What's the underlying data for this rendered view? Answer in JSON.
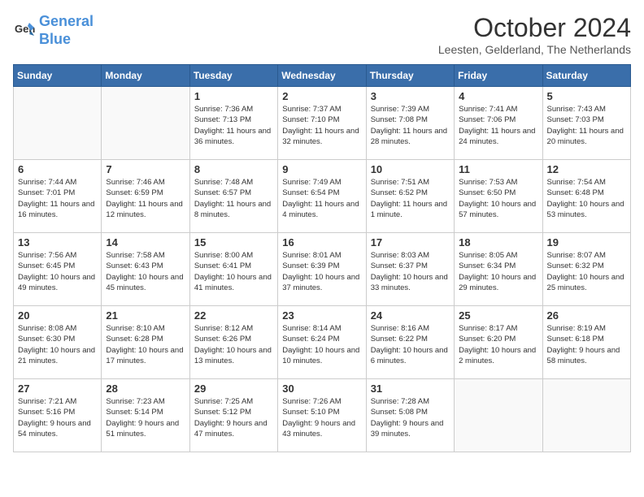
{
  "header": {
    "logo_line1": "General",
    "logo_line2": "Blue",
    "month": "October 2024",
    "location": "Leesten, Gelderland, The Netherlands"
  },
  "weekdays": [
    "Sunday",
    "Monday",
    "Tuesday",
    "Wednesday",
    "Thursday",
    "Friday",
    "Saturday"
  ],
  "weeks": [
    [
      {
        "day": "",
        "info": ""
      },
      {
        "day": "",
        "info": ""
      },
      {
        "day": "1",
        "info": "Sunrise: 7:36 AM\nSunset: 7:13 PM\nDaylight: 11 hours and 36 minutes."
      },
      {
        "day": "2",
        "info": "Sunrise: 7:37 AM\nSunset: 7:10 PM\nDaylight: 11 hours and 32 minutes."
      },
      {
        "day": "3",
        "info": "Sunrise: 7:39 AM\nSunset: 7:08 PM\nDaylight: 11 hours and 28 minutes."
      },
      {
        "day": "4",
        "info": "Sunrise: 7:41 AM\nSunset: 7:06 PM\nDaylight: 11 hours and 24 minutes."
      },
      {
        "day": "5",
        "info": "Sunrise: 7:43 AM\nSunset: 7:03 PM\nDaylight: 11 hours and 20 minutes."
      }
    ],
    [
      {
        "day": "6",
        "info": "Sunrise: 7:44 AM\nSunset: 7:01 PM\nDaylight: 11 hours and 16 minutes."
      },
      {
        "day": "7",
        "info": "Sunrise: 7:46 AM\nSunset: 6:59 PM\nDaylight: 11 hours and 12 minutes."
      },
      {
        "day": "8",
        "info": "Sunrise: 7:48 AM\nSunset: 6:57 PM\nDaylight: 11 hours and 8 minutes."
      },
      {
        "day": "9",
        "info": "Sunrise: 7:49 AM\nSunset: 6:54 PM\nDaylight: 11 hours and 4 minutes."
      },
      {
        "day": "10",
        "info": "Sunrise: 7:51 AM\nSunset: 6:52 PM\nDaylight: 11 hours and 1 minute."
      },
      {
        "day": "11",
        "info": "Sunrise: 7:53 AM\nSunset: 6:50 PM\nDaylight: 10 hours and 57 minutes."
      },
      {
        "day": "12",
        "info": "Sunrise: 7:54 AM\nSunset: 6:48 PM\nDaylight: 10 hours and 53 minutes."
      }
    ],
    [
      {
        "day": "13",
        "info": "Sunrise: 7:56 AM\nSunset: 6:45 PM\nDaylight: 10 hours and 49 minutes."
      },
      {
        "day": "14",
        "info": "Sunrise: 7:58 AM\nSunset: 6:43 PM\nDaylight: 10 hours and 45 minutes."
      },
      {
        "day": "15",
        "info": "Sunrise: 8:00 AM\nSunset: 6:41 PM\nDaylight: 10 hours and 41 minutes."
      },
      {
        "day": "16",
        "info": "Sunrise: 8:01 AM\nSunset: 6:39 PM\nDaylight: 10 hours and 37 minutes."
      },
      {
        "day": "17",
        "info": "Sunrise: 8:03 AM\nSunset: 6:37 PM\nDaylight: 10 hours and 33 minutes."
      },
      {
        "day": "18",
        "info": "Sunrise: 8:05 AM\nSunset: 6:34 PM\nDaylight: 10 hours and 29 minutes."
      },
      {
        "day": "19",
        "info": "Sunrise: 8:07 AM\nSunset: 6:32 PM\nDaylight: 10 hours and 25 minutes."
      }
    ],
    [
      {
        "day": "20",
        "info": "Sunrise: 8:08 AM\nSunset: 6:30 PM\nDaylight: 10 hours and 21 minutes."
      },
      {
        "day": "21",
        "info": "Sunrise: 8:10 AM\nSunset: 6:28 PM\nDaylight: 10 hours and 17 minutes."
      },
      {
        "day": "22",
        "info": "Sunrise: 8:12 AM\nSunset: 6:26 PM\nDaylight: 10 hours and 13 minutes."
      },
      {
        "day": "23",
        "info": "Sunrise: 8:14 AM\nSunset: 6:24 PM\nDaylight: 10 hours and 10 minutes."
      },
      {
        "day": "24",
        "info": "Sunrise: 8:16 AM\nSunset: 6:22 PM\nDaylight: 10 hours and 6 minutes."
      },
      {
        "day": "25",
        "info": "Sunrise: 8:17 AM\nSunset: 6:20 PM\nDaylight: 10 hours and 2 minutes."
      },
      {
        "day": "26",
        "info": "Sunrise: 8:19 AM\nSunset: 6:18 PM\nDaylight: 9 hours and 58 minutes."
      }
    ],
    [
      {
        "day": "27",
        "info": "Sunrise: 7:21 AM\nSunset: 5:16 PM\nDaylight: 9 hours and 54 minutes."
      },
      {
        "day": "28",
        "info": "Sunrise: 7:23 AM\nSunset: 5:14 PM\nDaylight: 9 hours and 51 minutes."
      },
      {
        "day": "29",
        "info": "Sunrise: 7:25 AM\nSunset: 5:12 PM\nDaylight: 9 hours and 47 minutes."
      },
      {
        "day": "30",
        "info": "Sunrise: 7:26 AM\nSunset: 5:10 PM\nDaylight: 9 hours and 43 minutes."
      },
      {
        "day": "31",
        "info": "Sunrise: 7:28 AM\nSunset: 5:08 PM\nDaylight: 9 hours and 39 minutes."
      },
      {
        "day": "",
        "info": ""
      },
      {
        "day": "",
        "info": ""
      }
    ]
  ]
}
